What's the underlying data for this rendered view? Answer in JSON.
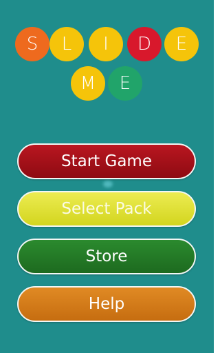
{
  "logo": {
    "row1": [
      "S",
      "L",
      "I",
      "D",
      "E"
    ],
    "row2": [
      "M",
      "E"
    ]
  },
  "menu": {
    "start_label": "Start Game",
    "select_label": "Select Pack",
    "store_label": "Store",
    "help_label": "Help"
  },
  "colors": {
    "background": "#1f8d8c",
    "orange": "#ee6a1e",
    "yellow": "#f5c40a",
    "red": "#d8182c",
    "green": "#21a46a",
    "start_button": "#a8111a",
    "select_button": "#e0e23a",
    "store_button": "#247a27",
    "help_button": "#d47b1a"
  }
}
